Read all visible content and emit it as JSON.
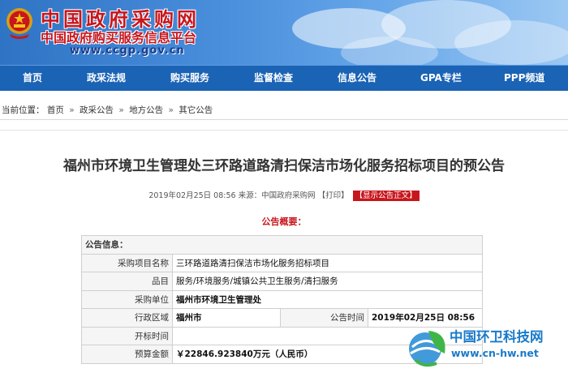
{
  "header": {
    "site_name": "中国政府采购网",
    "site_subtitle": "中国政府购买服务信息平台",
    "site_url": "www.ccgp.gov.cn"
  },
  "nav": {
    "items": [
      {
        "label": "首页"
      },
      {
        "label": "政采法规"
      },
      {
        "label": "购买服务"
      },
      {
        "label": "监督检查"
      },
      {
        "label": "信息公告"
      },
      {
        "label": "GPA专栏"
      },
      {
        "label": "PPP频道"
      }
    ]
  },
  "breadcrumb": {
    "prefix": "当前位置：",
    "items": [
      {
        "label": "首页"
      },
      {
        "label": "政采公告"
      },
      {
        "label": "地方公告"
      },
      {
        "label": "其它公告"
      }
    ],
    "separator": "»"
  },
  "article": {
    "title": "福州市环境卫生管理处三环路道路清扫保洁市场化服务招标项目的预公告",
    "meta_date": "2019年02月25日 08:56 来源：中国政府采购网",
    "print_label": "【打印】",
    "show_text_label": "【显示公告正文】",
    "summary_label": "公告概要："
  },
  "table": {
    "header": "公告信息：",
    "rows": {
      "project_name_label": "采购项目名称",
      "project_name_value": "三环路道路清扫保洁市场化服务招标项目",
      "category_label": "品目",
      "category_value": "服务/环境服务/城镇公共卫生服务/清扫服务",
      "unit_label": "采购单位",
      "unit_value": "福州市环境卫生管理处",
      "region_label": "行政区域",
      "region_value": "福州市",
      "notice_time_label": "公告时间",
      "notice_time_value": "2019年02月25日 08:56",
      "bid_time_label": "开标时间",
      "bid_time_value": "",
      "budget_label": "预算金额",
      "budget_value": "￥22846.923840万元（人民币）"
    }
  },
  "watermark": {
    "title": "中国环卫科技网",
    "url": "www.cn-hw.net"
  },
  "colors": {
    "nav_bg": "#1b63b5",
    "brand_red": "#c8161d",
    "watermark_blue": "#1a7ac9"
  }
}
